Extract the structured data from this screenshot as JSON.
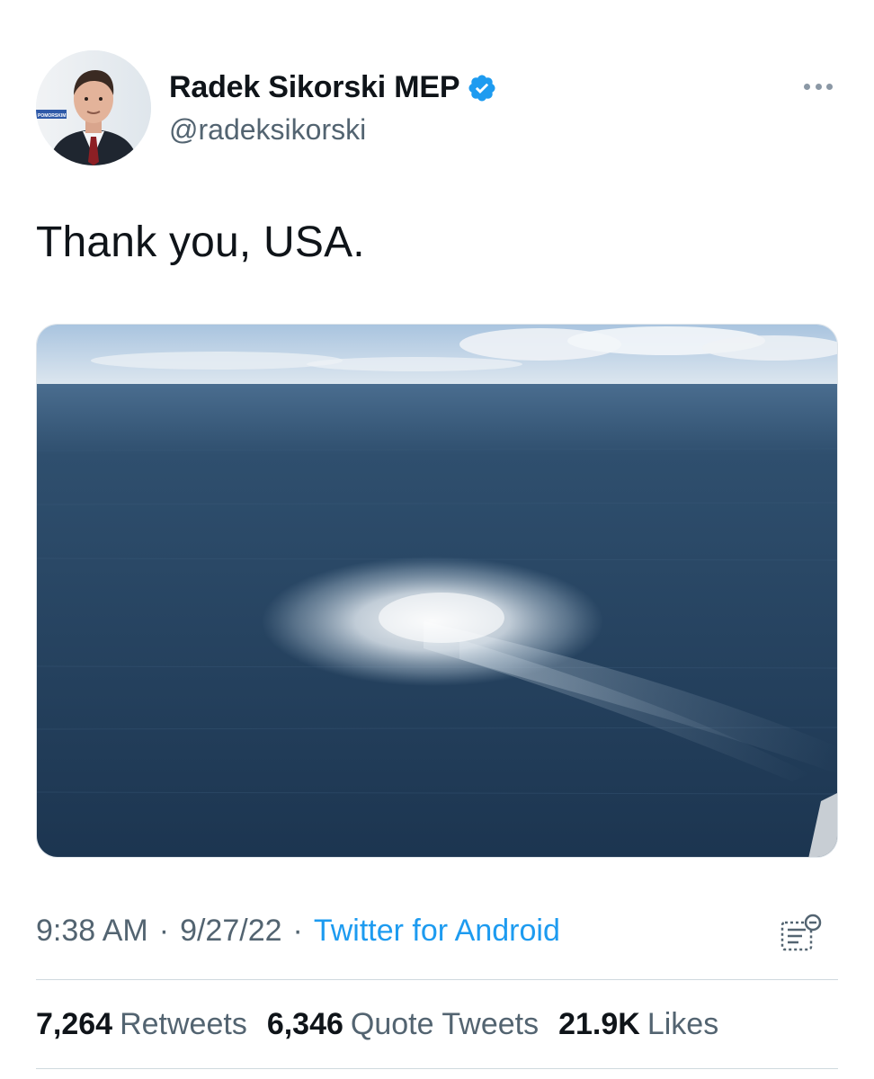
{
  "author": {
    "display_name": "Radek Sikorski MEP",
    "handle": "@radeksikorski",
    "verified": true,
    "avatar_label": "POMORSKIM"
  },
  "tweet": {
    "text": "Thank you, USA.",
    "media_description_icon": "aerial-sea-photo"
  },
  "meta": {
    "time": "9:38 AM",
    "separator1": "·",
    "date": "9/27/22",
    "separator2": "·",
    "source": "Twitter for Android"
  },
  "stats": [
    {
      "count": "7,264",
      "label": "Retweets"
    },
    {
      "count": "6,346",
      "label": "Quote Tweets"
    },
    {
      "count": "21.9K",
      "label": "Likes"
    }
  ],
  "colors": {
    "accent": "#1d9bf0",
    "secondary_text": "#536471",
    "primary_text": "#0f1419"
  }
}
